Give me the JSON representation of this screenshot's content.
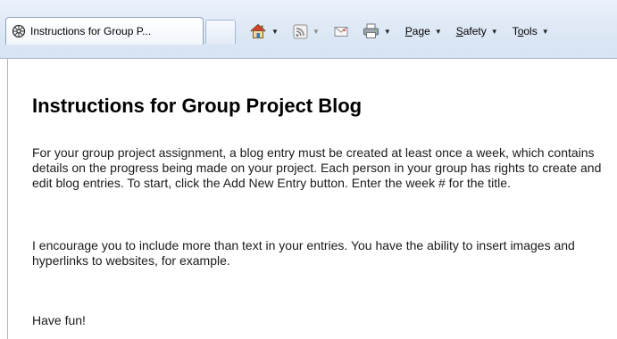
{
  "browser": {
    "tab_title": "Instructions for Group P...",
    "menus": [
      {
        "label_pre": "",
        "label_key": "P",
        "label_post": "age"
      },
      {
        "label_pre": "",
        "label_key": "S",
        "label_post": "afety"
      },
      {
        "label_pre": "T",
        "label_key": "o",
        "label_post": "ols"
      }
    ],
    "icons": {
      "tab": "website-icon",
      "home": "home-icon",
      "feeds": "rss-feed-icon",
      "mail": "mail-icon",
      "print": "print-icon"
    }
  },
  "page": {
    "title": "Instructions for Group Project Blog",
    "paragraphs": [
      "For your group project assignment, a blog entry must be created at least once a week, which contains details on the progress being made on your project.  Each person in your group has rights to create and edit blog entries.  To start, click the Add New Entry button.  Enter the week # for the title.",
      "I encourage you to include more than text in your entries.  You have the ability to insert images and hyperlinks to websites, for example.",
      "Have fun!"
    ]
  }
}
